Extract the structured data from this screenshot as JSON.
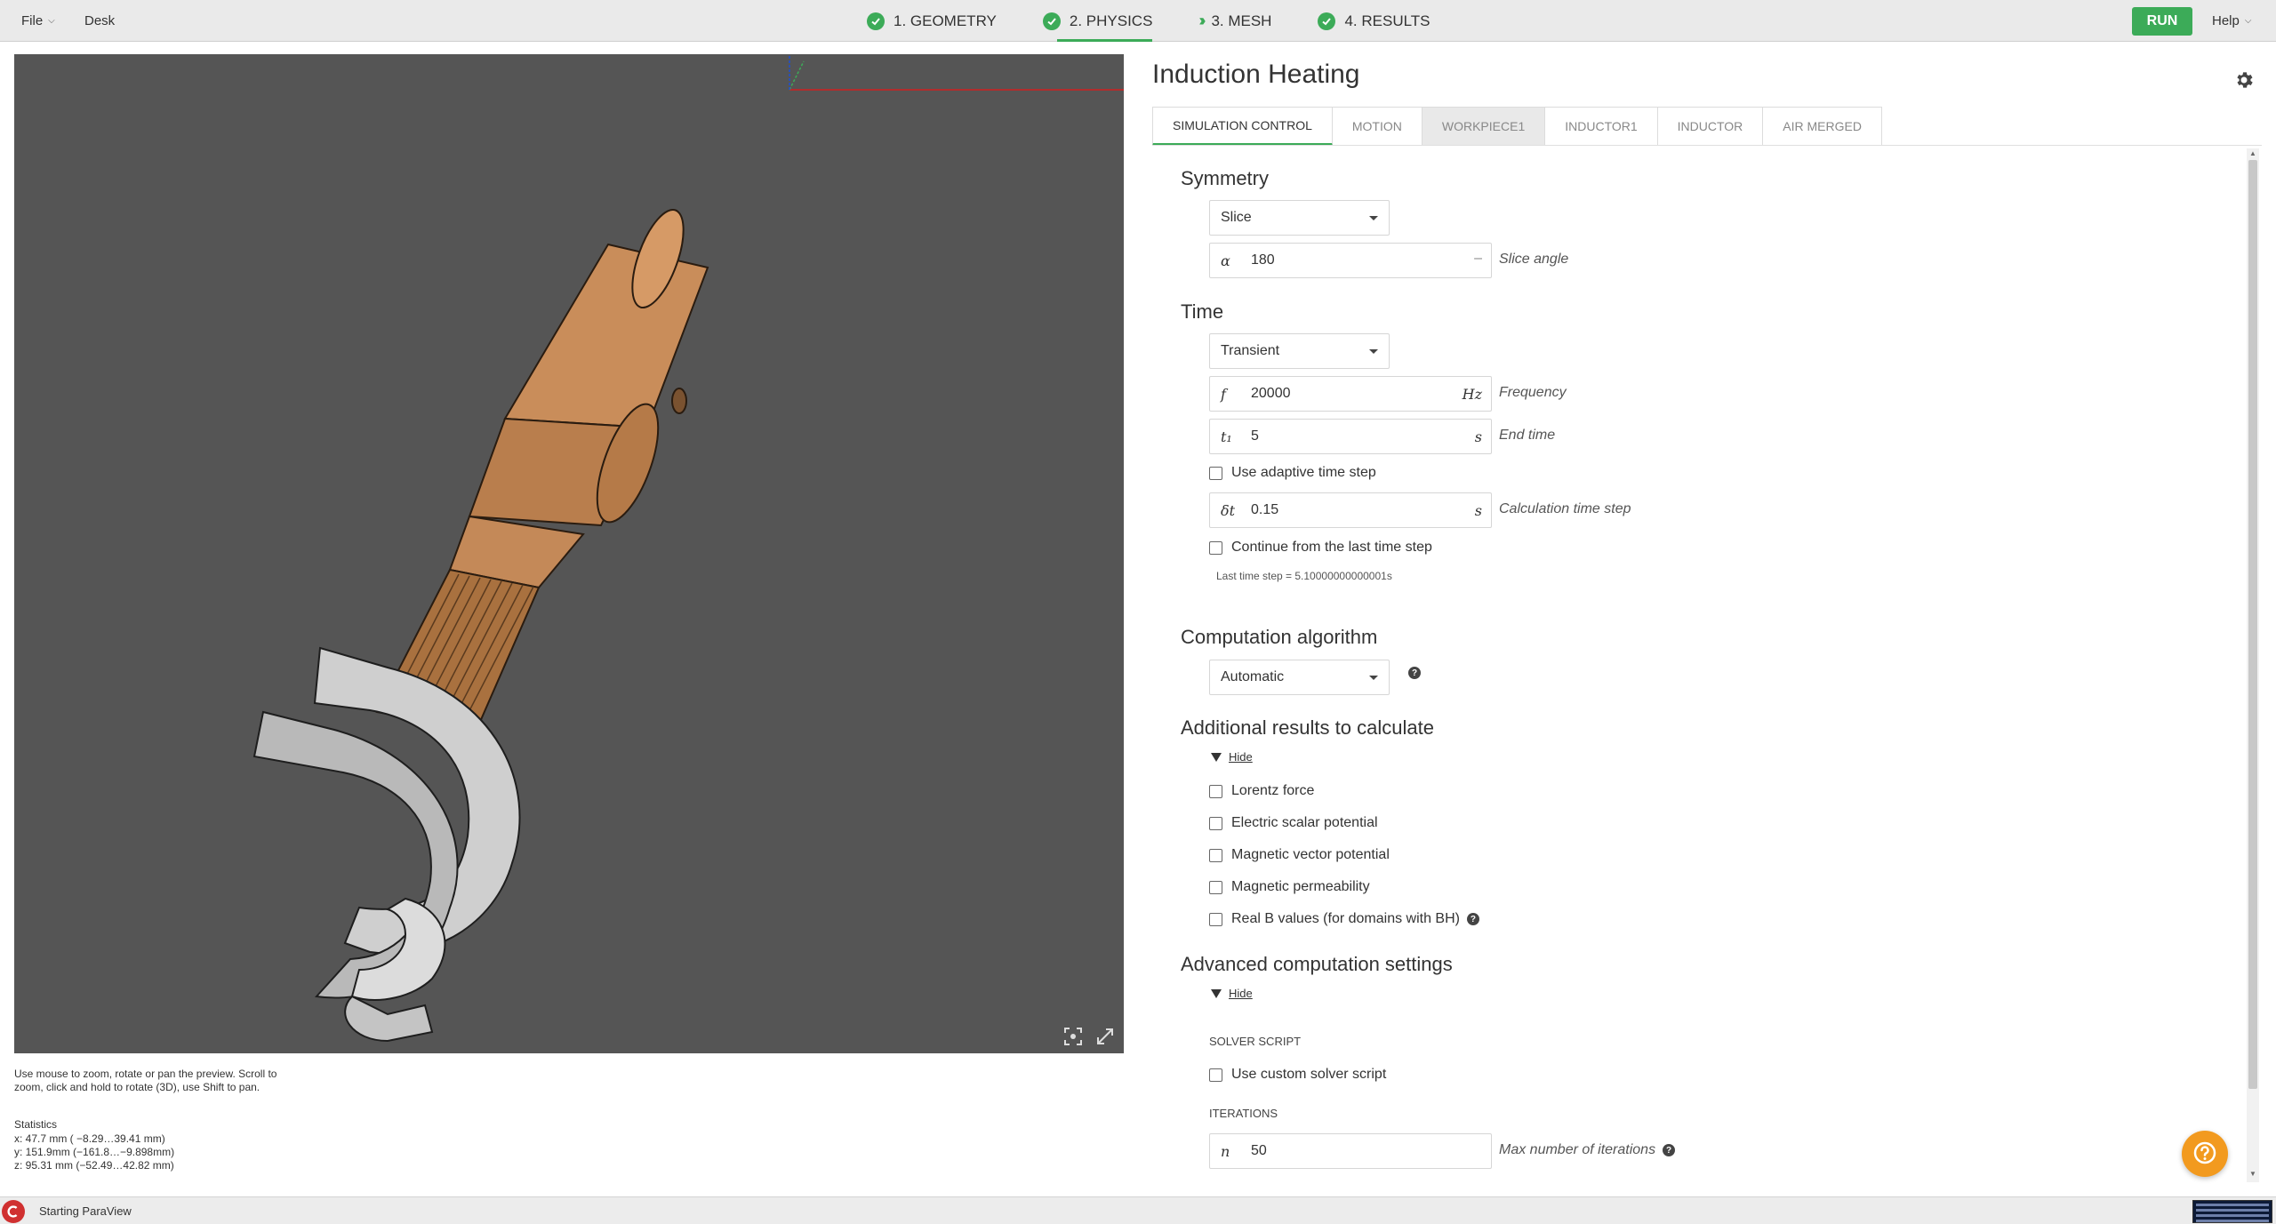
{
  "topbar": {
    "file_menu": "File",
    "desk_menu": "Desk",
    "steps": [
      {
        "label": "1. GEOMETRY",
        "status": "done"
      },
      {
        "label": "2. PHYSICS",
        "status": "done"
      },
      {
        "label": "3. MESH",
        "status": "next"
      },
      {
        "label": "4. RESULTS",
        "status": "done"
      }
    ],
    "run_label": "RUN",
    "help_menu": "Help"
  },
  "viewport": {
    "help_text": "Use mouse to zoom, rotate or pan the preview. Scroll to zoom, click and hold to rotate (3D), use Shift to pan.",
    "statistics_label": "Statistics",
    "stats": {
      "x": "x:   47.7 mm  (  −8.29…39.41   mm)",
      "y": "y:  151.9mm  (−161.8…−9.898mm)",
      "z": "z:  95.31 mm  (−52.49…42.82  mm)"
    }
  },
  "panel": {
    "title": "Induction Heating",
    "tabs": [
      "SIMULATION CONTROL",
      "MOTION",
      "WORKPIECE1",
      "INDUCTOR1",
      "INDUCTOR",
      "AIR MERGED"
    ],
    "active_tab": "SIMULATION CONTROL",
    "symmetry": {
      "title": "Symmetry",
      "mode": "Slice",
      "angle_symbol": "α",
      "angle_value": "180",
      "angle_unit": "–",
      "angle_label": "Slice angle"
    },
    "time": {
      "title": "Time",
      "mode": "Transient",
      "frequency": {
        "symbol": "f",
        "value": "20000",
        "unit": "Hz",
        "label": "Frequency"
      },
      "end_time": {
        "symbol": "t₁",
        "value": "5",
        "unit": "s",
        "label": "End time"
      },
      "adaptive_label": "Use adaptive time step",
      "time_step": {
        "symbol": "δt",
        "value": "0.15",
        "unit": "s",
        "label": "Calculation time step"
      },
      "continue_label": "Continue from the last time step",
      "last_step_note": "Last time step = 5.10000000000001s"
    },
    "algorithm": {
      "title": "Computation algorithm",
      "mode": "Automatic"
    },
    "additional": {
      "title": "Additional results to calculate",
      "hide_label": "Hide",
      "items": [
        "Lorentz force",
        "Electric scalar potential",
        "Magnetic vector potential",
        "Magnetic permeability",
        "Real B values (for domains with BH)"
      ]
    },
    "advanced": {
      "title": "Advanced computation settings",
      "hide_label": "Hide",
      "solver_script_head": "SOLVER SCRIPT",
      "custom_script_label": "Use custom solver script",
      "iterations_head": "ITERATIONS",
      "iterations": {
        "symbol": "n",
        "value": "50",
        "label": "Max number of iterations"
      }
    }
  },
  "statusbar": {
    "text": "Starting ParaView"
  },
  "colors": {
    "accent_green": "#3cab58",
    "viewport_bg": "#555555",
    "copper": "#c98d5a",
    "inductor_gray": "#c4c4c4",
    "fab_orange": "#f29a1f"
  }
}
